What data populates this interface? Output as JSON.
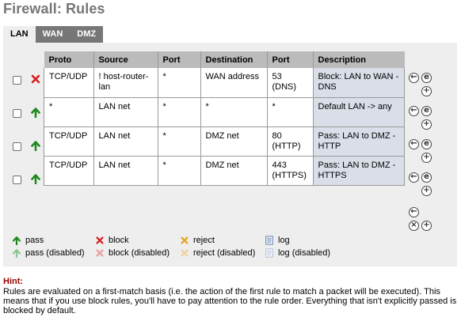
{
  "page_title": "Firewall: Rules",
  "tabs": [
    {
      "label": "LAN",
      "active": true
    },
    {
      "label": "WAN",
      "active": false
    },
    {
      "label": "DMZ",
      "active": false
    }
  ],
  "table": {
    "headers": [
      "Proto",
      "Source",
      "Port",
      "Destination",
      "Port",
      "Description"
    ],
    "rows": [
      {
        "action": "block",
        "proto": "TCP/UDP",
        "source": "! host-router-lan",
        "src_port": "*",
        "destination": "WAN address",
        "dst_port": "53 (DNS)",
        "description": "Block: LAN to WAN - DNS"
      },
      {
        "action": "pass",
        "proto": "*",
        "source": "LAN net",
        "src_port": "*",
        "destination": "*",
        "dst_port": "*",
        "description": "Default LAN -> any"
      },
      {
        "action": "pass",
        "proto": "TCP/UDP",
        "source": "LAN net",
        "src_port": "*",
        "destination": "DMZ net",
        "dst_port": "80 (HTTP)",
        "description": "Pass: LAN to DMZ - HTTP"
      },
      {
        "action": "pass",
        "proto": "TCP/UDP",
        "source": "LAN net",
        "src_port": "*",
        "destination": "DMZ net",
        "dst_port": "443 (HTTPS)",
        "description": "Pass: LAN to DMZ - HTTPS"
      }
    ]
  },
  "legend": {
    "pass": "pass",
    "pass_disabled": "pass (disabled)",
    "block": "block",
    "block_disabled": "block (disabled)",
    "reject": "reject",
    "reject_disabled": "reject (disabled)",
    "log": "log",
    "log_disabled": "log (disabled)"
  },
  "hint": {
    "title": "Hint:",
    "text": "Rules are evaluated on a first-match basis (i.e. the action of the first rule to match a packet will be executed). This means that if you use block rules, you'll have to pay attention to the rule order. Everything that isn't explicitly passed is blocked by default."
  },
  "colors": {
    "pass": "#1e8a1e",
    "pass_disabled": "#8fc48f",
    "block": "#d42020",
    "block_disabled": "#eaa0a0",
    "reject": "#e8a020",
    "reject_disabled": "#f2d09a",
    "header_bg": "#bbbbbb",
    "desc_bg": "#d9dee8",
    "panel_bg": "#eeeeee",
    "hint": "#990000"
  }
}
